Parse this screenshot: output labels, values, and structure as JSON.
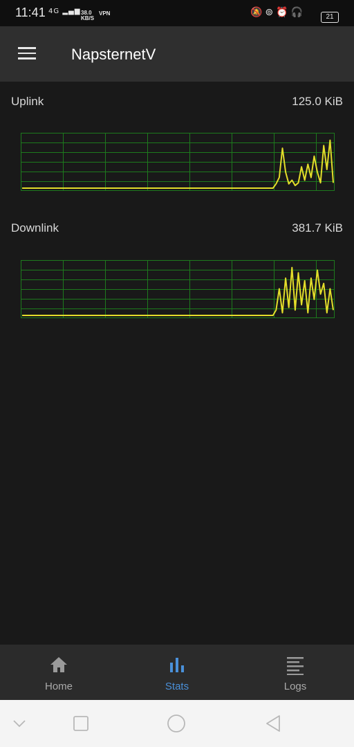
{
  "status_bar": {
    "time": "11:41",
    "network": "4G",
    "speed": "38.0",
    "speed_unit": "KB/S",
    "vpn": "VPN",
    "battery": "21"
  },
  "app_bar": {
    "title": "NapsternetV"
  },
  "stats": [
    {
      "label": "Uplink",
      "value": "125.0 KiB",
      "line_color": "#e3dd2a",
      "grid_color": "#1d7a1d",
      "trace": [
        0,
        0,
        0,
        0,
        0,
        0,
        0,
        0,
        0,
        0,
        0,
        0,
        0,
        0,
        0,
        0,
        0,
        0,
        0,
        0,
        0,
        0,
        0,
        0,
        0,
        0,
        0,
        0,
        0,
        0,
        0,
        0,
        0,
        0,
        0,
        0,
        0,
        0,
        0,
        0,
        0,
        0,
        0,
        0,
        0,
        0,
        0,
        0,
        0,
        0,
        0,
        0,
        0,
        0,
        0,
        0,
        0,
        0,
        0,
        0,
        0,
        0,
        0,
        0,
        0,
        0,
        0,
        0,
        0,
        0,
        0,
        0,
        0,
        0,
        0,
        0,
        0,
        0,
        0,
        0,
        0.08,
        0.2,
        0.75,
        0.3,
        0.08,
        0.15,
        0.05,
        0.1,
        0.4,
        0.15,
        0.45,
        0.2,
        0.6,
        0.3,
        0.1,
        0.8,
        0.35,
        0.9,
        0.1
      ]
    },
    {
      "label": "Downlink",
      "value": "381.7 KiB",
      "line_color": "#e3dd2a",
      "grid_color": "#1d7a1d",
      "trace": [
        0,
        0,
        0,
        0,
        0,
        0,
        0,
        0,
        0,
        0,
        0,
        0,
        0,
        0,
        0,
        0,
        0,
        0,
        0,
        0,
        0,
        0,
        0,
        0,
        0,
        0,
        0,
        0,
        0,
        0,
        0,
        0,
        0,
        0,
        0,
        0,
        0,
        0,
        0,
        0,
        0,
        0,
        0,
        0,
        0,
        0,
        0,
        0,
        0,
        0,
        0,
        0,
        0,
        0,
        0,
        0,
        0,
        0,
        0,
        0,
        0,
        0,
        0,
        0,
        0,
        0,
        0,
        0,
        0,
        0,
        0,
        0,
        0,
        0,
        0,
        0,
        0,
        0,
        0,
        0,
        0.1,
        0.5,
        0.05,
        0.7,
        0.15,
        0.9,
        0.1,
        0.8,
        0.2,
        0.65,
        0.05,
        0.7,
        0.3,
        0.85,
        0.4,
        0.6,
        0.05,
        0.5,
        0.1
      ]
    }
  ],
  "bottom_nav": [
    {
      "label": "Home",
      "icon": "home-icon",
      "active": false
    },
    {
      "label": "Stats",
      "icon": "stats-icon",
      "active": true
    },
    {
      "label": "Logs",
      "icon": "logs-icon",
      "active": false
    }
  ],
  "system_nav": [
    "chevron-down-icon",
    "recents-icon",
    "home-circle-icon",
    "back-icon"
  ]
}
